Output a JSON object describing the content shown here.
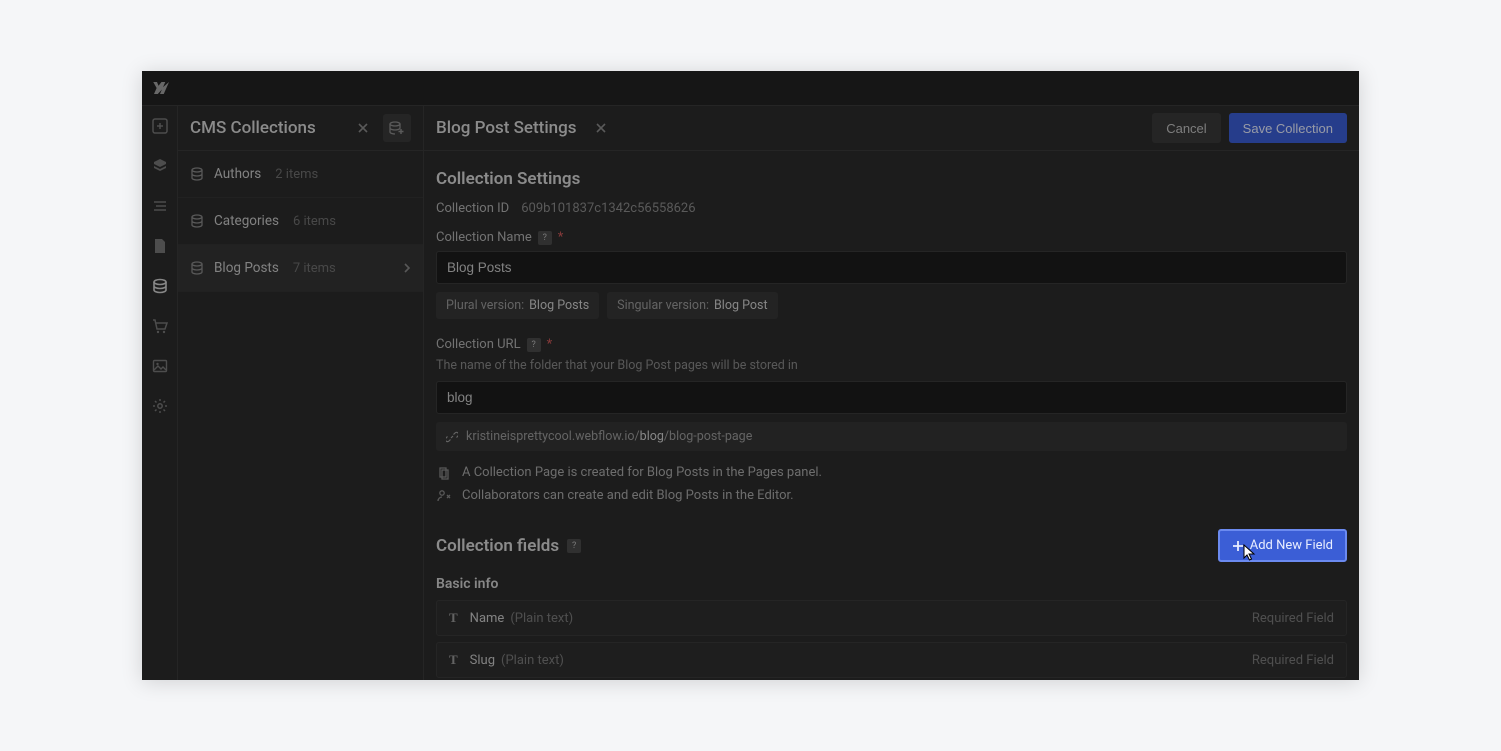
{
  "sidebar": {
    "panel_title": "CMS Collections",
    "items": [
      {
        "name": "Authors",
        "count": "2 items"
      },
      {
        "name": "Categories",
        "count": "6 items"
      },
      {
        "name": "Blog Posts",
        "count": "7 items"
      }
    ]
  },
  "settings": {
    "title": "Blog Post Settings",
    "cancel_label": "Cancel",
    "save_label": "Save Collection",
    "section_heading": "Collection Settings",
    "collection_id_label": "Collection ID",
    "collection_id_value": "609b101837c1342c56558626",
    "collection_name_label": "Collection Name",
    "collection_name_value": "Blog Posts",
    "plural_label": "Plural version:",
    "plural_value": "Blog Posts",
    "singular_label": "Singular version:",
    "singular_value": "Blog Post",
    "collection_url_label": "Collection URL",
    "collection_url_desc": "The name of the folder that your Blog Post pages will be stored in",
    "collection_url_value": "blog",
    "url_preview_prefix": "kristineisprettycool.webflow.io/",
    "url_preview_mid": "blog",
    "url_preview_suffix": "/blog-post-page",
    "info_page": "A Collection Page is created for Blog Posts in the Pages panel.",
    "info_collab": "Collaborators can create and edit Blog Posts in the Editor.",
    "fields_heading": "Collection fields",
    "add_field_label": "Add New Field",
    "basic_info_heading": "Basic info",
    "fields": [
      {
        "name": "Name",
        "type": "(Plain text)",
        "required": "Required Field"
      },
      {
        "name": "Slug",
        "type": "(Plain text)",
        "required": "Required Field"
      }
    ]
  },
  "colors": {
    "primary": "#3b5ed6"
  }
}
